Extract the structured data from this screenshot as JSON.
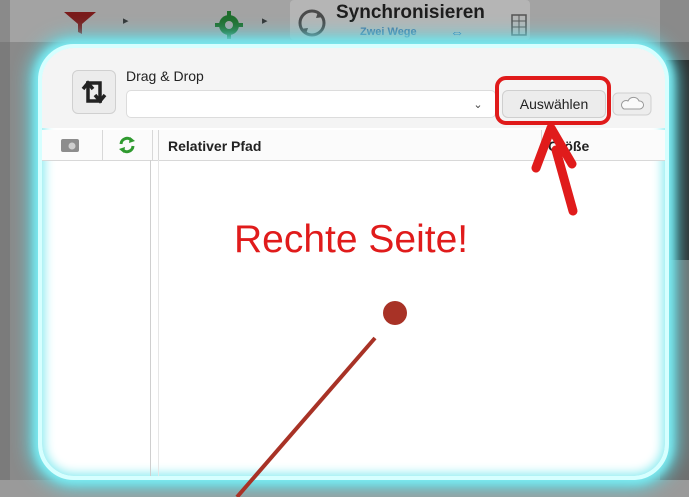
{
  "background_app": {
    "sync_title": "Synchronisieren",
    "sync_subtitle": "Zwei Wege",
    "sync_arrows": "⇔",
    "caret": "▸"
  },
  "panel": {
    "drag_label": "Drag & Drop",
    "path_value": "",
    "dropdown_glyph": "⌄",
    "choose_label": "Auswählen"
  },
  "columns": {
    "relative_path": "Relativer Pfad",
    "size": "Größe"
  },
  "annotation": {
    "title": "Rechte Seite!"
  },
  "colors": {
    "highlight_glow": "#5fdce6",
    "annotation_red": "#e01b1b",
    "pointer_line": "#a83226"
  },
  "icons": [
    "filter-icon",
    "gear-icon",
    "sync-icon",
    "grid-icon",
    "swap-icon",
    "cloud-icon",
    "folder-view-icon",
    "refresh-icon"
  ]
}
